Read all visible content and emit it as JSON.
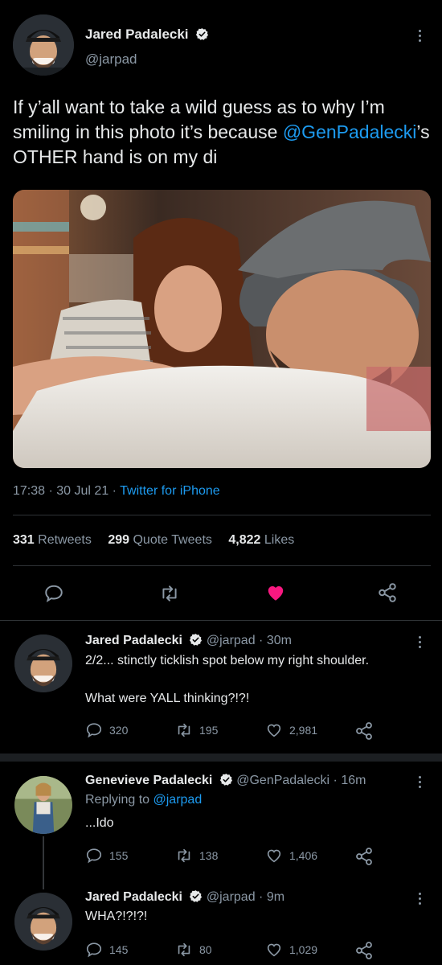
{
  "main_tweet": {
    "display_name": "Jared Padalecki",
    "handle": "@jarpad",
    "text_prefix": "If y’all want to take a wild guess as to why I’m smiling in this photo it’s because ",
    "mention": "@GenPadalecki",
    "text_suffix": "’s OTHER hand is on my di",
    "time": "17:38",
    "date": "30 Jul 21",
    "source": "Twitter for iPhone",
    "stats": {
      "retweets_count": "331",
      "retweets_label": "Retweets",
      "quotes_count": "299",
      "quotes_label": "Quote Tweets",
      "likes_count": "4,822",
      "likes_label": "Likes"
    }
  },
  "replies": [
    {
      "display_name": "Jared Padalecki",
      "handle": "@jarpad",
      "age": "30m",
      "line1": "2/2... stinctly ticklish spot below my right shoulder.",
      "line2": "What were YALL thinking?!?!",
      "replies": "320",
      "retweets": "195",
      "likes": "2,981"
    },
    {
      "display_name": "Genevieve Padalecki",
      "handle": "@GenPadalecki",
      "age": "16m",
      "replying_label": "Replying to",
      "replying_to": "@jarpad",
      "text": "...Ido",
      "replies": "155",
      "retweets": "138",
      "likes": "1,406"
    },
    {
      "display_name": "Jared Padalecki",
      "handle": "@jarpad",
      "age": "9m",
      "text": "WHA?!?!?!",
      "replies": "145",
      "retweets": "80",
      "likes": "1,029"
    }
  ],
  "colors": {
    "background": "#000000",
    "accent": "#1d9bf0",
    "like": "#f91880",
    "muted": "#8b98a5"
  },
  "icons": [
    "more-icon",
    "verified-icon",
    "reply-icon",
    "retweet-icon",
    "like-icon",
    "share-icon"
  ]
}
